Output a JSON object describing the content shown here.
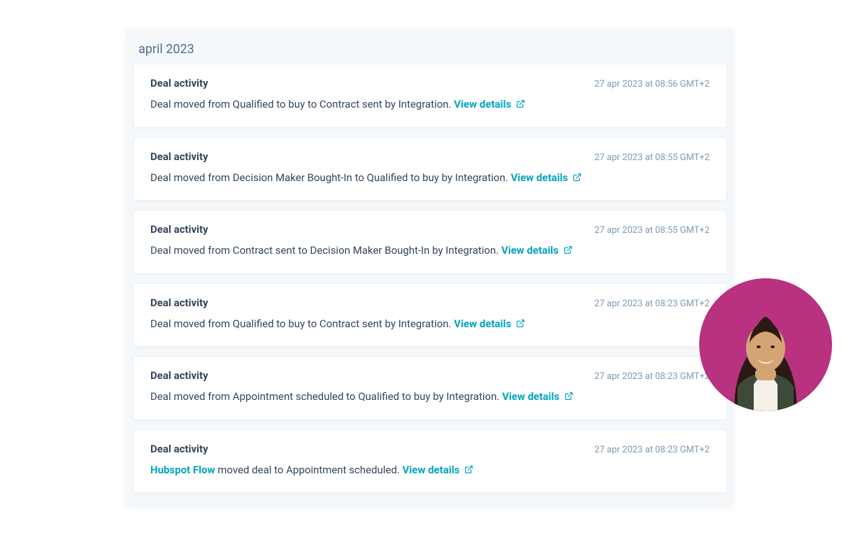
{
  "header": {
    "title": "april 2023"
  },
  "view_details_label": "View details",
  "activities": [
    {
      "title": "Deal activity",
      "timestamp": "27 apr 2023 at 08:56 GMT+2",
      "description": "Deal moved from Qualified to buy to Contract sent by Integration."
    },
    {
      "title": "Deal activity",
      "timestamp": "27 apr 2023 at 08:55 GMT+2",
      "description": "Deal moved from Decision Maker Bought-In to Qualified to buy by Integration."
    },
    {
      "title": "Deal activity",
      "timestamp": "27 apr 2023 at 08:55 GMT+2",
      "description": "Deal moved from Contract sent to Decision Maker Bought-In by Integration."
    },
    {
      "title": "Deal activity",
      "timestamp": "27 apr 2023 at 08:23 GMT+2",
      "description": "Deal moved from Qualified to buy to Contract sent by Integration."
    },
    {
      "title": "Deal activity",
      "timestamp": "27 apr 2023 at 08:23 GMT+2",
      "description": "Deal moved from Appointment scheduled to Qualified to buy by Integration."
    },
    {
      "title": "Deal activity",
      "timestamp": "27 apr 2023 at 08:23 GMT+2",
      "actor": "Hubspot Flow",
      "description_after_actor": " moved deal to Appointment scheduled."
    }
  ],
  "avatar": {
    "background_color": "#b83280"
  }
}
